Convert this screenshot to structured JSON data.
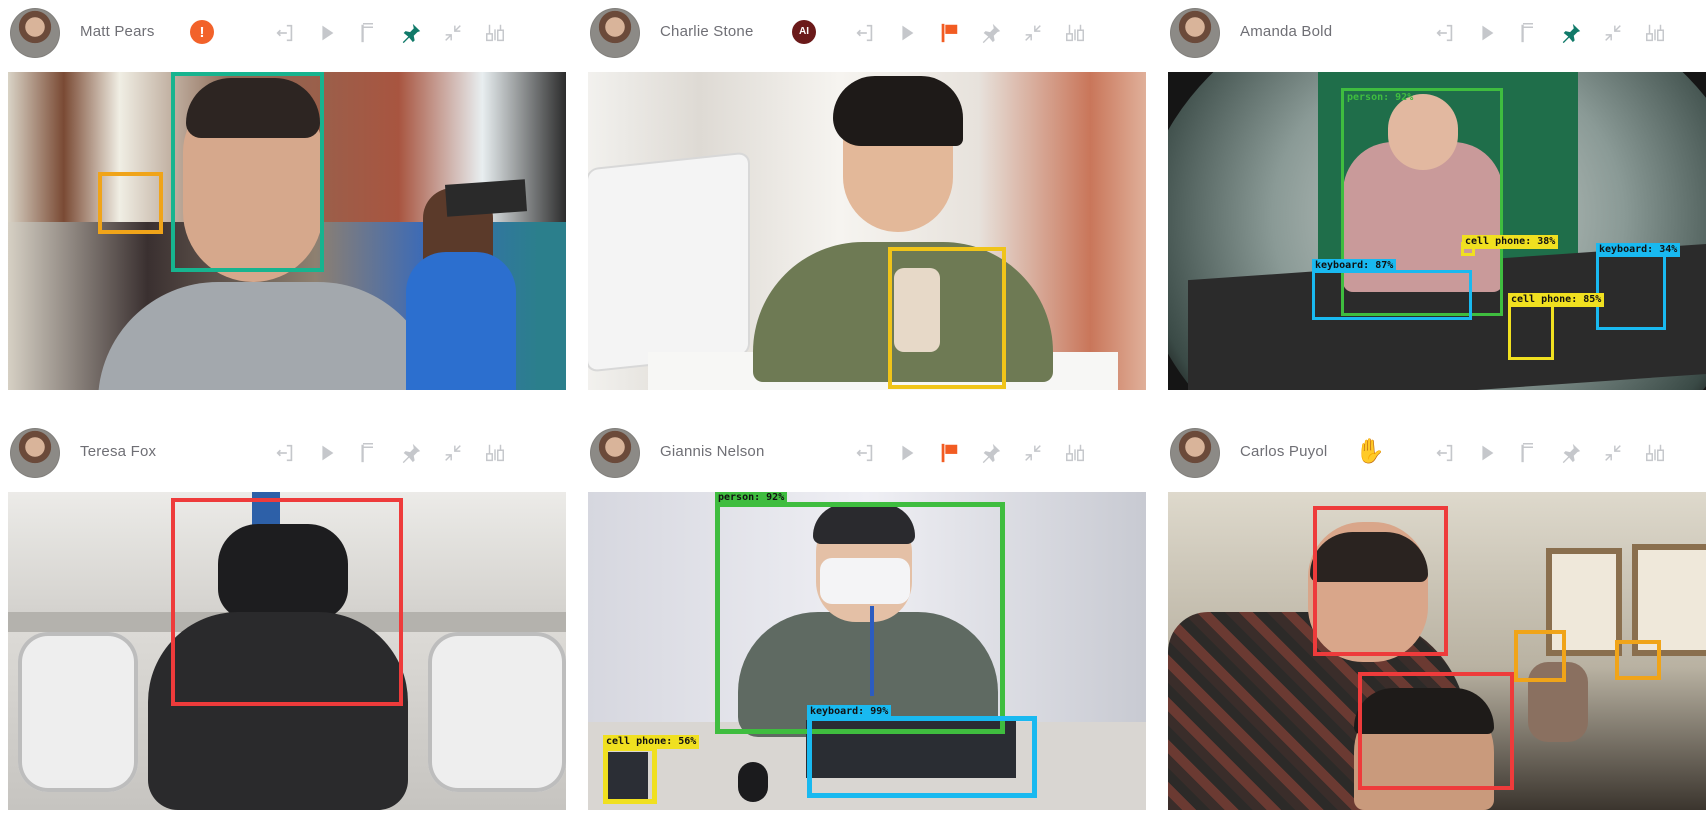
{
  "colors": {
    "accent_orange": "#f2622a",
    "pin_green": "#117a69",
    "icon_gray": "#c5c7cb",
    "box_green": "#17b48f",
    "box_yellow": "#f0c419",
    "box_red": "#ee3b3b",
    "box_blue": "#19b9f0",
    "detect_green": "#3fbd3f"
  },
  "tiles": [
    {
      "name": "Matt Pears",
      "badge": {
        "icon": "alert-icon",
        "text": "!"
      },
      "pinned": true,
      "flagged": false,
      "detections": []
    },
    {
      "name": "Charlie Stone",
      "badge": {
        "icon": "ai-badge-icon",
        "text": "AI"
      },
      "pinned": false,
      "flagged": true,
      "detections": []
    },
    {
      "name": "Amanda Bold",
      "badge": null,
      "pinned": true,
      "flagged": false,
      "detections": [
        {
          "label": "person: 92%"
        },
        {
          "label": "cell phone: 38%"
        },
        {
          "label": "keyboard: 87%"
        },
        {
          "label": "keyboard: 34%"
        },
        {
          "label": "cell phone: 85%"
        }
      ]
    },
    {
      "name": "Teresa Fox",
      "badge": null,
      "pinned": false,
      "flagged": false,
      "detections": []
    },
    {
      "name": "Giannis Nelson",
      "badge": null,
      "pinned": false,
      "flagged": true,
      "detections": [
        {
          "label": "person: 92%"
        },
        {
          "label": "keyboard: 99%"
        },
        {
          "label": "cell phone: 56%"
        }
      ]
    },
    {
      "name": "Carlos Puyol",
      "badge": {
        "icon": "raised-hand-icon",
        "text": "✋"
      },
      "pinned": false,
      "flagged": false,
      "detections": []
    }
  ]
}
